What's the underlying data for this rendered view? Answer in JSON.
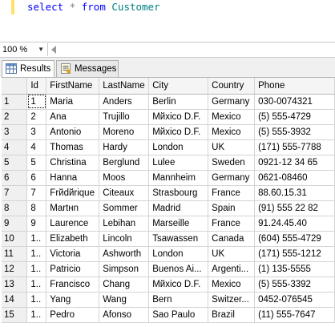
{
  "editor": {
    "query_parts": [
      "select",
      "*",
      "from",
      "Customer"
    ]
  },
  "zoom": {
    "value": "100 %"
  },
  "tabs": [
    {
      "label": "Results",
      "icon": "grid-results-icon",
      "active": true
    },
    {
      "label": "Messages",
      "icon": "messages-icon",
      "active": false
    }
  ],
  "grid": {
    "columns": [
      "Id",
      "FirstName",
      "LastName",
      "City",
      "Country",
      "Phone"
    ],
    "rows": [
      [
        "1",
        "1",
        "Maria",
        "Anders",
        "Berlin",
        "Germany",
        "030-0074321"
      ],
      [
        "2",
        "2",
        "Ana",
        "Trujillo",
        "Mйxico D.F.",
        "Mexico",
        "(5) 555-4729"
      ],
      [
        "3",
        "3",
        "Antonio",
        "Moreno",
        "Mйxico D.F.",
        "Mexico",
        "(5) 555-3932"
      ],
      [
        "4",
        "4",
        "Thomas",
        "Hardy",
        "London",
        "UK",
        "(171) 555-7788"
      ],
      [
        "5",
        "5",
        "Christina",
        "Berglund",
        "Lulee",
        "Sweden",
        "0921-12 34 65"
      ],
      [
        "6",
        "6",
        "Hanna",
        "Moos",
        "Mannheim",
        "Germany",
        "0621-08460"
      ],
      [
        "7",
        "7",
        "Frйdйrique",
        "Citeaux",
        "Strasbourg",
        "France",
        "88.60.15.31"
      ],
      [
        "8",
        "8",
        "Martнn",
        "Sommer",
        "Madrid",
        "Spain",
        "(91) 555 22 82"
      ],
      [
        "9",
        "9",
        "Laurence",
        "Lebihan",
        "Marseille",
        "France",
        "91.24.45.40"
      ],
      [
        "10",
        "1..",
        "Elizabeth",
        "Lincoln",
        "Tsawassen",
        "Canada",
        "(604) 555-4729"
      ],
      [
        "11",
        "1..",
        "Victoria",
        "Ashworth",
        "London",
        "UK",
        "(171) 555-1212"
      ],
      [
        "12",
        "1..",
        "Patricio",
        "Simpson",
        "Buenos Ai...",
        "Argenti...",
        "(1) 135-5555"
      ],
      [
        "13",
        "1..",
        "Francisco",
        "Chang",
        "Mйxico D.F.",
        "Mexico",
        "(5) 555-3392"
      ],
      [
        "14",
        "1..",
        "Yang",
        "Wang",
        "Bern",
        "Switzer...",
        "0452-076545"
      ],
      [
        "15",
        "1..",
        "Pedro",
        "Afonso",
        "Sao Paulo",
        "Brazil",
        "(11) 555-7647"
      ]
    ]
  }
}
